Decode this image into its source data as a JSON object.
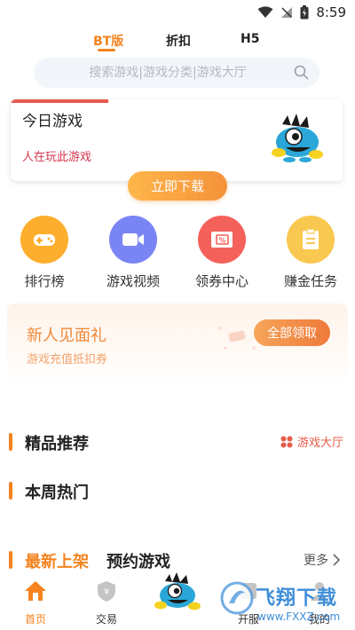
{
  "status_bar": {
    "time": "8:59"
  },
  "top_tabs": [
    {
      "label": "BT版",
      "active": true
    },
    {
      "label": "折扣",
      "active": false
    },
    {
      "label": "H5",
      "active": false
    }
  ],
  "search": {
    "placeholder": "搜索游戏|游戏分类|游戏大厅"
  },
  "today_card": {
    "title": "今日游戏",
    "subtitle": "人在玩此游戏",
    "download_label": "立即下载"
  },
  "quick_actions": [
    {
      "label": "排行榜",
      "icon": "gamepad-icon",
      "color": "#fdae2c"
    },
    {
      "label": "游戏视频",
      "icon": "video-icon",
      "color": "#7a85f5"
    },
    {
      "label": "领券中心",
      "icon": "coupon-icon",
      "color": "#f4615b"
    },
    {
      "label": "赚金任务",
      "icon": "clipboard-icon",
      "color": "#f9c850"
    }
  ],
  "gift_banner": {
    "title": "新人见面礼",
    "subtitle": "游戏充值抵扣券",
    "button": "全部领取"
  },
  "sections": {
    "featured": "精品推荐",
    "game_hall": "游戏大厅",
    "weekly_hot": "本周热门",
    "new_release": "最新上架",
    "reserve": "预约游戏",
    "more": "更多"
  },
  "bottom_tabs": [
    {
      "label": "首页",
      "active": true
    },
    {
      "label": "交易",
      "active": false
    },
    {
      "label": "开服",
      "active": false
    },
    {
      "label": "我的",
      "active": false
    }
  ],
  "watermark": {
    "text": "飞翔下载",
    "url": "www.FXXZ.com"
  },
  "colors": {
    "accent": "#f5831f",
    "red": "#d2354f"
  }
}
